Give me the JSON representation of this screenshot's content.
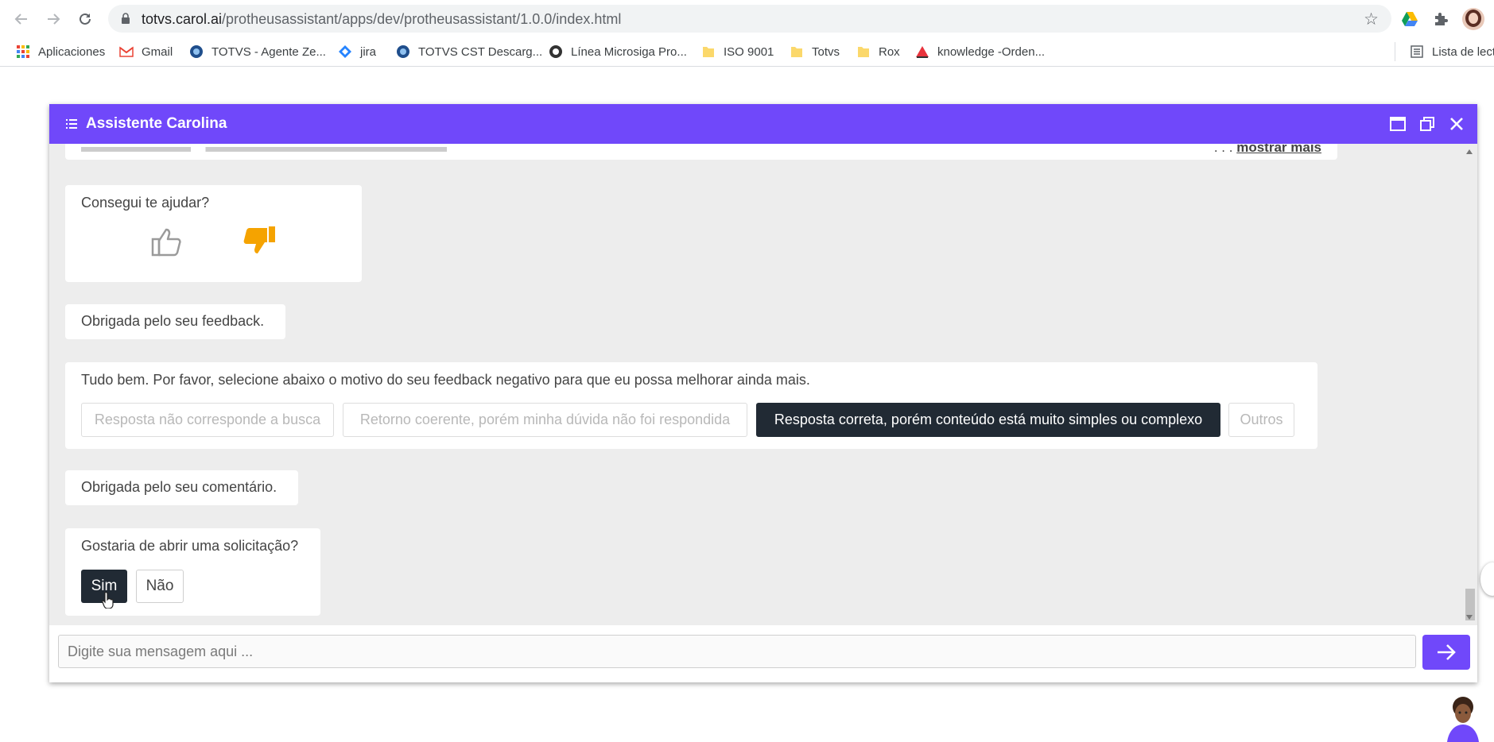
{
  "browser": {
    "url_host": "totvs.carol.ai",
    "url_path": "/protheusassistant/apps/dev/protheusassistant/1.0.0/index.html",
    "bookmarks": [
      {
        "label": "Aplicaciones",
        "icon": "apps-grid-icon"
      },
      {
        "label": "Gmail",
        "icon": "gmail-icon"
      },
      {
        "label": "TOTVS - Agente Ze...",
        "icon": "globe-icon"
      },
      {
        "label": "jira",
        "icon": "jira-icon"
      },
      {
        "label": "TOTVS CST Descarg...",
        "icon": "globe-icon"
      },
      {
        "label": "Línea Microsiga Pro...",
        "icon": "circle-logo-icon"
      },
      {
        "label": "ISO 9001",
        "icon": "folder-icon"
      },
      {
        "label": "Totvs",
        "icon": "folder-icon"
      },
      {
        "label": "Rox",
        "icon": "folder-icon"
      },
      {
        "label": "knowledge -Orden...",
        "icon": "triangle-logo-icon"
      }
    ],
    "reading_list": "Lista de lect"
  },
  "chat": {
    "title": "Assistente Carolina",
    "show_more": "mostrar mais",
    "show_more_prefix": ". . .",
    "feedback_question": "Consegui te ajudar?",
    "thanks_feedback": "Obrigada pelo seu feedback.",
    "negative_prompt": "Tudo bem. Por favor, selecione abaixo o motivo do seu feedback negativo para que eu possa melhorar ainda mais.",
    "options": [
      "Resposta não corresponde a busca",
      "Retorno coerente, porém minha dúvida não foi respondida",
      "Resposta correta, porém conteúdo está muito simples ou complexo",
      "Outros"
    ],
    "selected_option_index": 2,
    "thanks_comment": "Obrigada pelo seu comentário.",
    "open_request_question": "Gostaria de abrir uma solicitação?",
    "yes_label": "Sim",
    "no_label": "Não",
    "input_placeholder": "Digite sua mensagem aqui ...",
    "colors": {
      "header": "#7048fa",
      "dark_button": "#212a34",
      "thumb_down": "#f5a300"
    }
  }
}
